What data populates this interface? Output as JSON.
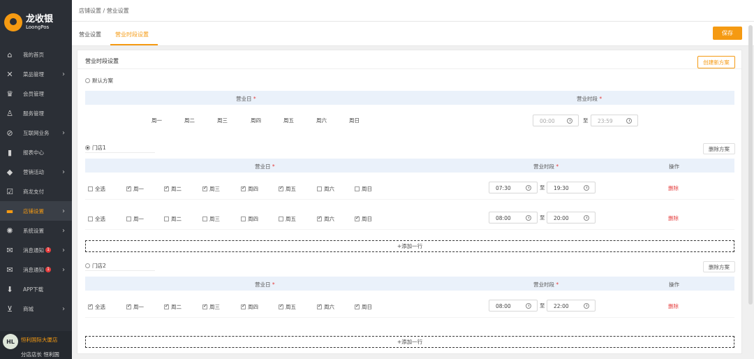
{
  "brand": {
    "name_cn": "龙收银",
    "name_en": "LoongPos",
    "accent": "#f59a12"
  },
  "sidebar": {
    "items": [
      {
        "label": "我的首页",
        "icon": "home-icon"
      },
      {
        "label": "菜品管理",
        "icon": "utensils-icon",
        "arrow": true
      },
      {
        "label": "会员管理",
        "icon": "crown-icon"
      },
      {
        "label": "服务管理",
        "icon": "person-icon"
      },
      {
        "label": "互联网业务",
        "icon": "compass-icon",
        "arrow": true
      },
      {
        "label": "报表中心",
        "icon": "bar-chart-icon"
      },
      {
        "label": "营销活动",
        "icon": "tag-icon",
        "arrow": true
      },
      {
        "label": "商龙支付",
        "icon": "check-square-icon"
      },
      {
        "label": "店铺设置",
        "icon": "store-icon",
        "arrow": true,
        "active": true
      },
      {
        "label": "系统设置",
        "icon": "gear-icon",
        "arrow": true
      },
      {
        "label": "消息通知",
        "icon": "mail-icon",
        "badge": "1",
        "arrow": true
      },
      {
        "label": "消息通知",
        "icon": "mail-icon",
        "badge": "1",
        "arrow": true
      },
      {
        "label": "APP下载",
        "icon": "download-icon"
      },
      {
        "label": "商城",
        "icon": "cart-icon",
        "arrow": true
      }
    ],
    "user": {
      "initials": "HL",
      "store": "恒利国际大厦店",
      "role": "分店店长 恒利国"
    }
  },
  "header": {
    "breadcrumb": "店铺设置 / 营业设置"
  },
  "tabs": [
    {
      "label": "营业设置"
    },
    {
      "label": "营业时段设置",
      "active": true
    }
  ],
  "toolbar": {
    "save_label": "保存"
  },
  "panel": {
    "title": "营业时段设置",
    "create_label": "创建新方案",
    "delete_plan_label": "删除方案",
    "col_day": "营业日",
    "col_time": "营业时段",
    "col_op": "操作",
    "required": "*",
    "to": "至",
    "select_all": "全选",
    "delete_label": "删除",
    "add_row_label": "+添加一行",
    "days": [
      "周一",
      "周二",
      "周三",
      "周四",
      "周五",
      "周六",
      "周日"
    ],
    "default_plan": {
      "name": "默认方案",
      "start": "00:00",
      "end": "23:59"
    },
    "plans": [
      {
        "name": "门店1",
        "selected": true,
        "rows": [
          {
            "all": false,
            "days": [
              true,
              true,
              true,
              true,
              true,
              false,
              false
            ],
            "start": "07:30",
            "end": "19:30"
          },
          {
            "all": false,
            "days": [
              false,
              false,
              false,
              false,
              false,
              true,
              true
            ],
            "start": "08:00",
            "end": "20:00"
          }
        ]
      },
      {
        "name": "门店2",
        "selected": false,
        "rows": [
          {
            "all": true,
            "days": [
              true,
              true,
              true,
              true,
              true,
              true,
              true
            ],
            "start": "08:00",
            "end": "22:00"
          }
        ]
      }
    ]
  }
}
